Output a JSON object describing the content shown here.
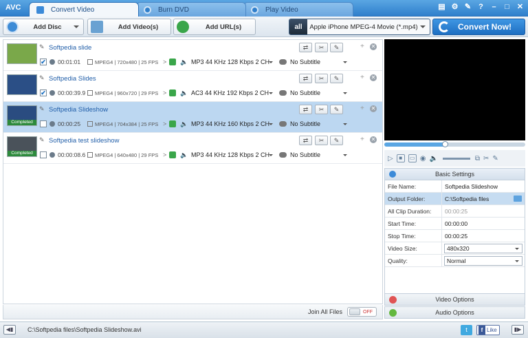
{
  "app": {
    "logo": "AVC"
  },
  "tabs": [
    {
      "label": "Convert Video"
    },
    {
      "label": "Burn DVD"
    },
    {
      "label": "Play Video"
    }
  ],
  "toolbar": {
    "add_disc": "Add Disc",
    "add_videos": "Add Video(s)",
    "add_urls": "Add URL(s)",
    "profile_icon_text": "all",
    "profile": "Apple iPhone MPEG-4 Movie (*.mp4)",
    "convert": "Convert Now!"
  },
  "videos": [
    {
      "name": "Softpedia slide",
      "duration": "00:01:01",
      "format": "MPEG4 | 720x480 | 25 FPS",
      "audio": "MP3 44 KHz 128 Kbps 2 CH",
      "subtitle": "No Subtitle",
      "checked": "✔",
      "badge": "",
      "thumb_color": "#7aa84a"
    },
    {
      "name": "Softpedia Slides",
      "duration": "00:00:39.9",
      "format": "MPEG4 | 960x720 | 29 FPS",
      "audio": "AC3 44 KHz 192 Kbps 2 CH",
      "subtitle": "No Subtitle",
      "checked": "✔",
      "badge": "",
      "thumb_color": "#2b4f86"
    },
    {
      "name": "Softpedia Slideshow",
      "duration": "00:00:25",
      "format": "MPEG4 | 704x384 | 25 FPS",
      "audio": "MP3 44 KHz 160 Kbps 2 CH",
      "subtitle": "No Subtitle",
      "checked": "",
      "badge": "Completed",
      "thumb_color": "#2a4c80"
    },
    {
      "name": "Softpedia test slideshow",
      "duration": "00:00:08.6",
      "format": "MPEG4 | 640x480 | 29 FPS",
      "audio": "MP3 44 KHz 128 Kbps 2 CH",
      "subtitle": "No Subtitle",
      "checked": "",
      "badge": "Completed",
      "thumb_color": "#4a525a"
    }
  ],
  "list_footer": {
    "join_label": "Join All Files",
    "toggle": "OFF"
  },
  "settings": {
    "header": "Basic Settings",
    "rows": [
      {
        "key": "File Name:",
        "value": "Softpedia Slideshow"
      },
      {
        "key": "Output Folder:",
        "value": "C:\\Softpedia files"
      },
      {
        "key": "All Clip Duration:",
        "value": "00:00:25"
      },
      {
        "key": "Start Time:",
        "value": "00:00:00"
      },
      {
        "key": "Stop Time:",
        "value": "00:00:25"
      },
      {
        "key": "Video Size:",
        "value": "480x320"
      },
      {
        "key": "Quality:",
        "value": "Normal"
      }
    ]
  },
  "options": {
    "video": "Video Options",
    "audio": "Audio Options"
  },
  "status": {
    "path": "C:\\Softpedia files\\Softpedia Slideshow.avi",
    "like": "Like"
  }
}
